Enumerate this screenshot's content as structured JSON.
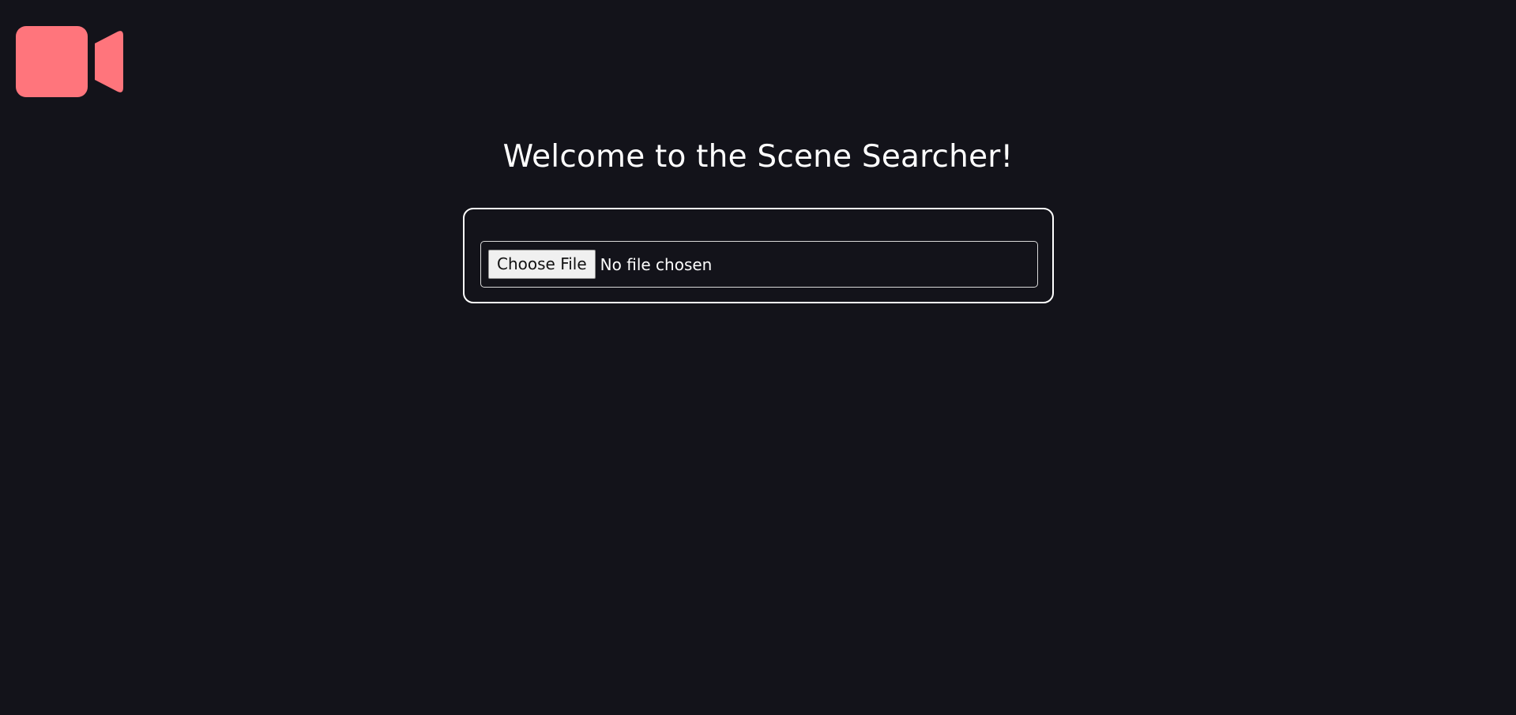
{
  "header": {
    "logo_icon": "video-camera-icon",
    "logo_color": "#ff757c"
  },
  "main": {
    "title": "Welcome to the Scene Searcher!",
    "file_input": {
      "button_label": "Choose File",
      "status": "No file chosen"
    }
  },
  "theme": {
    "background": "#13131a",
    "text": "#ffffff",
    "border": "#ffffff"
  }
}
